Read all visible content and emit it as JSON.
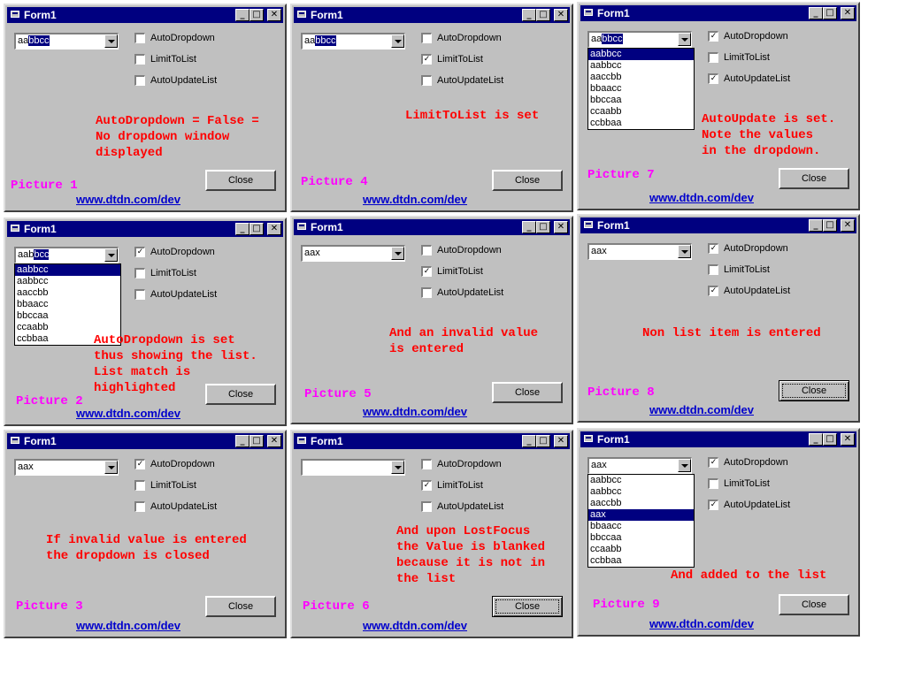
{
  "window_title": "Form1",
  "checkbox_labels": [
    "AutoDropdown",
    "LimitToList",
    "AutoUpdateList"
  ],
  "close_label": "Close",
  "link": "www.dtdn.com/dev",
  "panels": [
    {
      "id": 1,
      "caption": "Picture 1",
      "combo_text": "aa",
      "combo_selected": "bbcc",
      "checks": [
        false,
        false,
        false
      ],
      "note": "AutoDropdown = False =\nNo dropdown window\ndisplayed",
      "dropdown": [],
      "highlight": -1,
      "default_btn": false
    },
    {
      "id": 4,
      "caption": "Picture 4",
      "combo_text": "aa",
      "combo_selected": "bbcc",
      "checks": [
        false,
        true,
        false
      ],
      "note": "LimitToList is set",
      "dropdown": [],
      "highlight": -1,
      "default_btn": false
    },
    {
      "id": 7,
      "caption": "Picture 7",
      "combo_text": "aa",
      "combo_selected": "bbcc",
      "checks": [
        true,
        false,
        true
      ],
      "note": "AutoUpdate is set.\nNote the values\nin the dropdown.",
      "dropdown": [
        "aabbcc",
        "aabbcc",
        "aaccbb",
        "bbaacc",
        "bbccaa",
        "ccaabb",
        "ccbbaa"
      ],
      "highlight": 0,
      "default_btn": false
    },
    {
      "id": 2,
      "caption": "Picture 2",
      "combo_text": "aab",
      "combo_selected": "bcc",
      "checks": [
        true,
        false,
        false
      ],
      "note": "AutoDropdown is set\nthus showing the list.\nList match is\nhighlighted",
      "dropdown": [
        "aabbcc",
        "aabbcc",
        "aaccbb",
        "bbaacc",
        "bbccaa",
        "ccaabb",
        "ccbbaa"
      ],
      "highlight": 0,
      "default_btn": false
    },
    {
      "id": 5,
      "caption": "Picture 5",
      "combo_text": "aax",
      "combo_selected": "",
      "checks": [
        false,
        true,
        false
      ],
      "note": "And an invalid value\nis entered",
      "dropdown": [],
      "highlight": -1,
      "default_btn": false
    },
    {
      "id": 8,
      "caption": "Picture 8",
      "combo_text": "aax",
      "combo_selected": "",
      "checks": [
        true,
        false,
        true
      ],
      "note": "Non list item is entered",
      "dropdown": [],
      "highlight": -1,
      "default_btn": true
    },
    {
      "id": 3,
      "caption": "Picture 3",
      "combo_text": "aax",
      "combo_selected": "",
      "checks": [
        true,
        false,
        false
      ],
      "note": "If invalid value is entered\nthe dropdown is closed",
      "dropdown": [],
      "highlight": -1,
      "default_btn": false
    },
    {
      "id": 6,
      "caption": "Picture 6",
      "combo_text": "",
      "combo_selected": "",
      "checks": [
        false,
        true,
        false
      ],
      "note": "And upon LostFocus\nthe Value is blanked\nbecause it is not in\nthe list",
      "dropdown": [],
      "highlight": -1,
      "default_btn": true
    },
    {
      "id": 9,
      "caption": "Picture 9",
      "combo_text": "aax",
      "combo_selected": "",
      "checks": [
        true,
        false,
        true
      ],
      "note": "And added to the list",
      "dropdown": [
        "aabbcc",
        "aabbcc",
        "aaccbb",
        "aax",
        "bbaacc",
        "bbccaa",
        "ccaabb",
        "ccbbaa"
      ],
      "highlight": 3,
      "default_btn": false
    }
  ]
}
